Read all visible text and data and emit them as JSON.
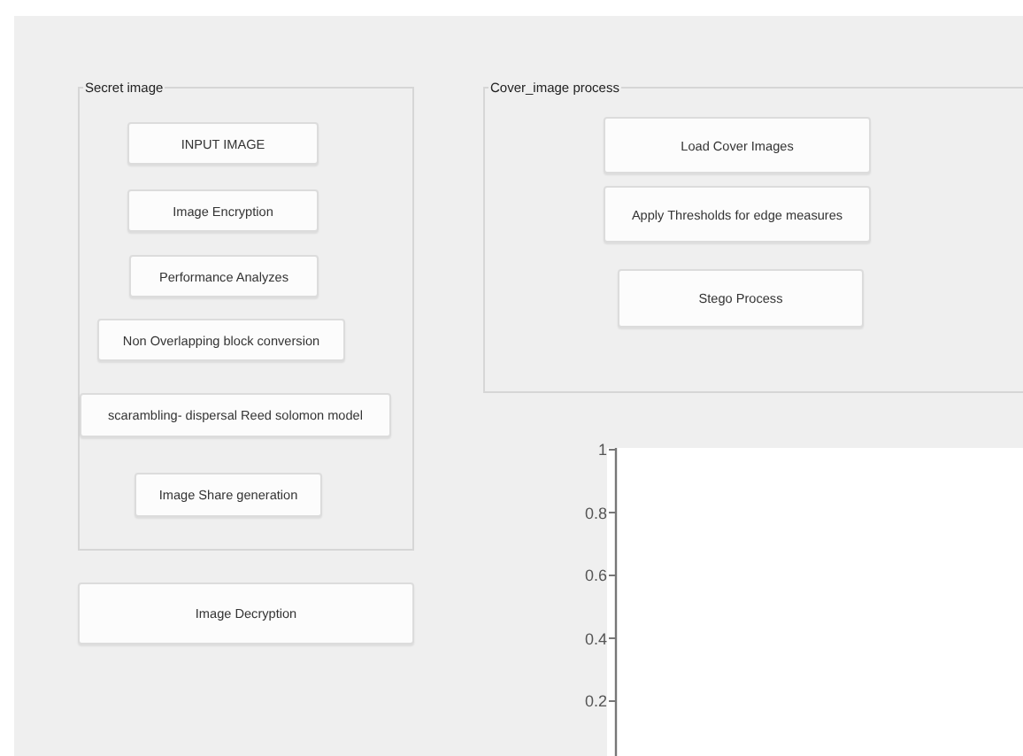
{
  "secret_panel": {
    "title": "Secret image",
    "buttons": [
      "INPUT IMAGE",
      "Image Encryption",
      "Performance Analyzes",
      "Non Overlapping block conversion",
      "scarambling- dispersal Reed solomon model",
      "Image Share generation"
    ]
  },
  "decrypt_button": "Image Decryption",
  "cover_panel": {
    "title": "Cover_image process",
    "buttons": [
      "Load Cover Images",
      "Apply Thresholds for edge measures",
      "Stego Process"
    ]
  },
  "axes": {
    "y_tick_labels": [
      "1",
      "0.8",
      "0.6",
      "0.4",
      "0.2"
    ]
  }
}
